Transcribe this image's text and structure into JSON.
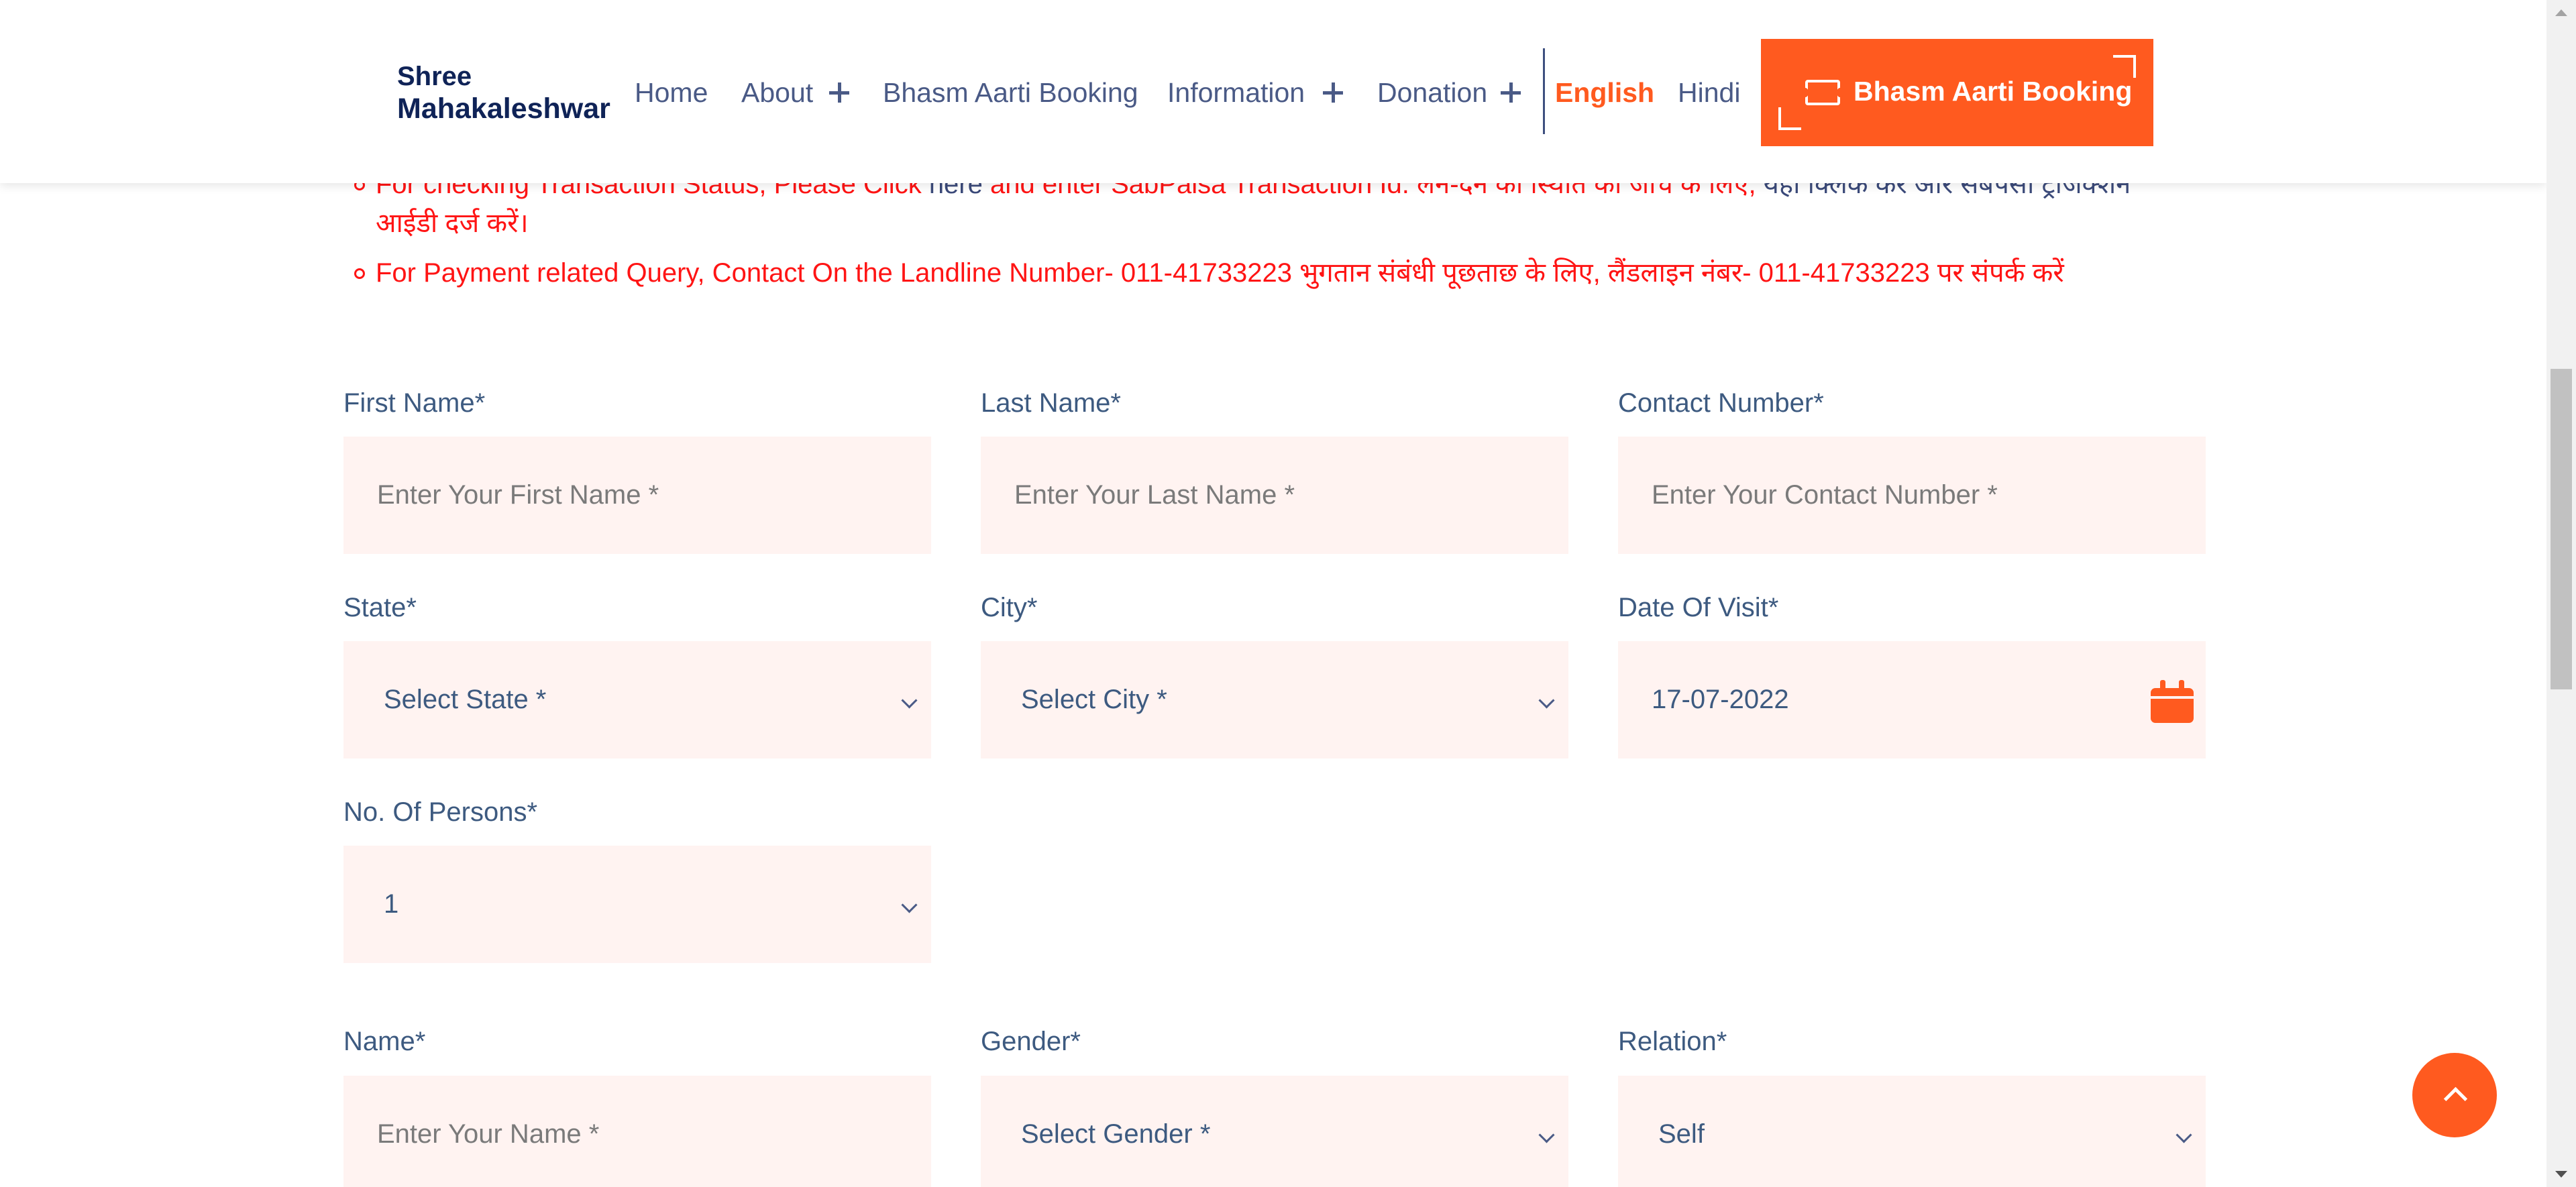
{
  "header": {
    "logo_line1": "Shree",
    "logo_line2": "Mahakaleshwar",
    "nav": {
      "home": "Home",
      "about": "About",
      "bhasm_booking": "Bhasm Aarti Booking",
      "information": "Information",
      "donation": "Donation"
    },
    "lang_english": "English",
    "lang_hindi": "Hindi",
    "cta_button": "Bhasm Aarti Booking"
  },
  "notices": [
    {
      "pre": "For checking Transaction Status, Please Click ",
      "link": "here",
      "mid": " and enter SabPaisa Transaction Id. लेन-देन की स्थिति की जांच के लिए, ",
      "link2": "यहां क्लिक करें और सबपैसा ट्रांजेक्शन",
      "line2": "आईडी दर्ज करें।"
    },
    {
      "text": "For Payment related Query, Contact On the Landline Number- 011-41733223 भुगतान संबंधी पूछताछ के लिए, लैंडलाइन नंबर- 011-41733223 पर संपर्क करें"
    }
  ],
  "form": {
    "first_name": {
      "label": "First Name*",
      "placeholder": "Enter Your First Name *"
    },
    "last_name": {
      "label": "Last Name*",
      "placeholder": "Enter Your Last Name *"
    },
    "contact": {
      "label": "Contact Number*",
      "placeholder": "Enter Your Contact Number *"
    },
    "state": {
      "label": "State*",
      "value": "Select State *"
    },
    "city": {
      "label": "City*",
      "value": "Select City *"
    },
    "date_of_visit": {
      "label": "Date Of Visit*",
      "value": "17-07-2022"
    },
    "persons": {
      "label": "No. Of Persons*",
      "value": "1"
    },
    "name": {
      "label": "Name*",
      "placeholder": "Enter Your Name *"
    },
    "gender": {
      "label": "Gender*",
      "value": "Select Gender *"
    },
    "relation": {
      "label": "Relation*",
      "value": "Self"
    }
  },
  "colors": {
    "accent": "#ff5a1f",
    "notice_text": "#ff1414",
    "label_text": "#3d5a80",
    "field_bg": "#fff3f1",
    "logo": "#0f2357"
  },
  "icons": {
    "calendar": "calendar-icon",
    "ticket": "ticket-icon",
    "scroll_top": "chevron-up-icon"
  }
}
